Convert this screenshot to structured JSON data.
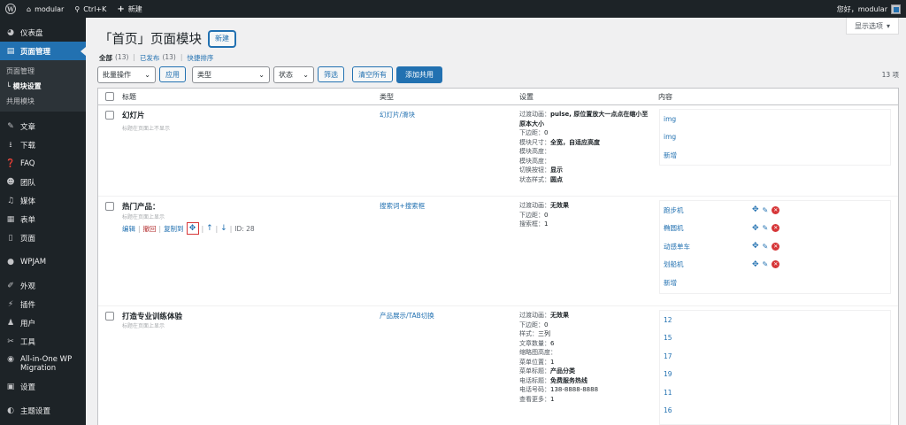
{
  "adminbar": {
    "site_name": "modular",
    "shortcut": "Ctrl+K",
    "new_label": "新建",
    "greeting": "您好，modular"
  },
  "sidebar": {
    "items": [
      {
        "label": "仪表盘",
        "icon": "dashboard-icon"
      },
      {
        "label": "页面管理",
        "icon": "page-manage-icon",
        "active": true
      },
      {
        "label": "文章",
        "icon": "pin-icon"
      },
      {
        "label": "下载",
        "icon": "download-icon"
      },
      {
        "label": "FAQ",
        "icon": "question-icon"
      },
      {
        "label": "团队",
        "icon": "team-icon"
      },
      {
        "label": "媒体",
        "icon": "media-icon"
      },
      {
        "label": "表单",
        "icon": "form-icon"
      },
      {
        "label": "页面",
        "icon": "page-icon"
      },
      {
        "label": "WPJAM",
        "icon": "wpjam-icon"
      },
      {
        "label": "外观",
        "icon": "appearance-icon"
      },
      {
        "label": "插件",
        "icon": "plugin-icon"
      },
      {
        "label": "用户",
        "icon": "user-icon"
      },
      {
        "label": "工具",
        "icon": "tools-icon"
      },
      {
        "label": "All-in-One WP Migration",
        "icon": "migration-icon"
      },
      {
        "label": "设置",
        "icon": "settings-icon"
      },
      {
        "label": "主题设置",
        "icon": "theme-settings-icon"
      }
    ],
    "submenu": [
      {
        "label": "页面管理"
      },
      {
        "label": "└ 模块设置",
        "current": true
      },
      {
        "label": "共用模块"
      }
    ]
  },
  "screen_options": "显示选项",
  "page": {
    "title": "「首页」页面模块",
    "new_button": "新建"
  },
  "filters": {
    "all": "全部",
    "all_count": "(13)",
    "published": "已发布",
    "published_count": "(13)",
    "quick_sort": "快捷排序"
  },
  "tablenav": {
    "bulk_action": "批量操作",
    "apply": "应用",
    "type": "类型",
    "status": "状态",
    "filter": "筛选",
    "clear_all": "清空所有",
    "add_shared": "添加共用",
    "count": "13 项"
  },
  "columns": {
    "title": "标题",
    "type": "类型",
    "settings": "设置",
    "content": "内容"
  },
  "rows": [
    {
      "title": "幻灯片",
      "note": "标题在页面上不显示",
      "type": "幻灯片/滑块",
      "settings": [
        {
          "k": "过渡动画：",
          "v": "pulse, 原位置放大一点点在缩小至原本大小"
        },
        {
          "k": "下边距：",
          "v": "0"
        },
        {
          "k": "模块尺寸：",
          "v": "全宽，自适应高度"
        },
        {
          "k": "模块高度：",
          "v": ""
        },
        {
          "k": "模块高度：",
          "v": ""
        },
        {
          "k": "切换按钮：",
          "v": "显示"
        },
        {
          "k": "状态样式：",
          "v": "圆点"
        }
      ],
      "content": [
        "img",
        "img",
        "新增"
      ]
    },
    {
      "title": "热门产品：",
      "note": "标题在页面上显示",
      "actions": {
        "edit": "编辑",
        "revoke": "撤回",
        "copy": "复制到",
        "id": "ID: 28"
      },
      "type": "搜索词+搜索框",
      "settings": [
        {
          "k": "过渡动画：",
          "v": "无效果"
        },
        {
          "k": "下边距：",
          "v": "0"
        },
        {
          "k": "搜索框：",
          "v": "1"
        }
      ],
      "content": [
        "跑步机",
        "椭圆机",
        "动感单车",
        "划船机",
        "新增"
      ]
    },
    {
      "title": "打造专业训练体验",
      "note": "标题在页面上显示",
      "type": "产品展示/TAB切换",
      "settings": [
        {
          "k": "过渡动画：",
          "v": "无效果"
        },
        {
          "k": "下边距：",
          "v": "0"
        },
        {
          "k": "样式：",
          "v": "三列"
        },
        {
          "k": "文章数量：",
          "v": "6"
        },
        {
          "k": "缩略图高度：",
          "v": ""
        },
        {
          "k": "菜单位置：",
          "v": "1"
        },
        {
          "k": "菜单标题：",
          "v": "产品分类"
        },
        {
          "k": "电话标题：",
          "v": "免费服务热线"
        },
        {
          "k": "电话号码：",
          "v": "138-8888-8888"
        },
        {
          "k": "查看更多：",
          "v": "1"
        }
      ],
      "content": [
        "12",
        "15",
        "17",
        "19",
        "11",
        "16"
      ]
    }
  ]
}
